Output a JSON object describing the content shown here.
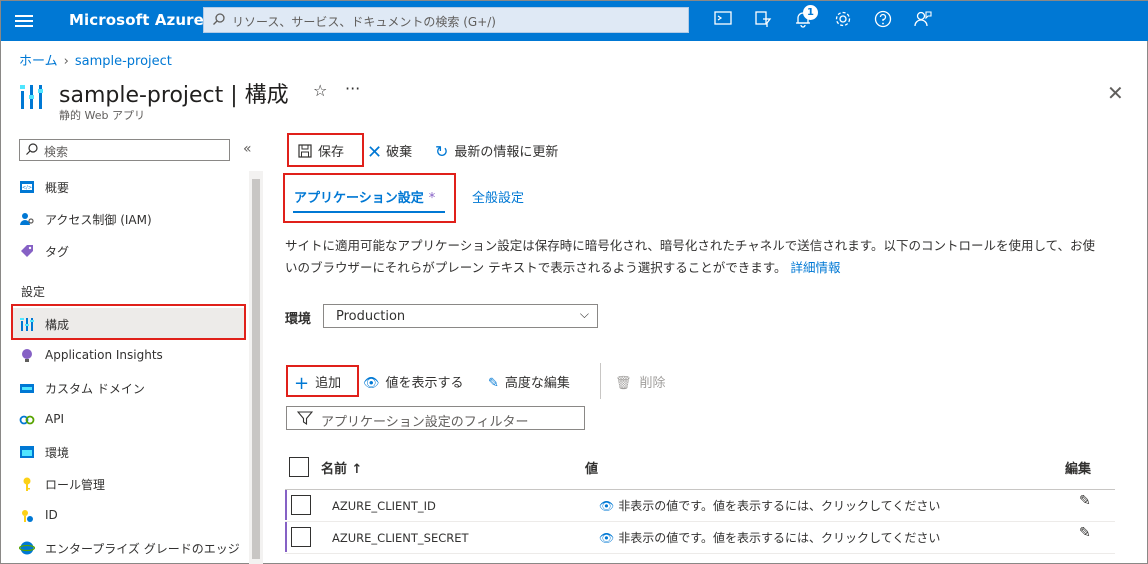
{
  "topbar": {
    "brand": "Microsoft Azure",
    "search_placeholder": "リソース、サービス、ドキュメントの検索 (G+/)",
    "notification_count": "1",
    "icons": [
      "cloud-shell-icon",
      "directory-filter-icon",
      "bell-icon",
      "gear-icon",
      "help-icon",
      "feedback-icon"
    ]
  },
  "breadcrumb": {
    "home": "ホーム",
    "current": "sample-project"
  },
  "header": {
    "title": "sample-project | 構成",
    "subtitle": "静的 Web アプリ"
  },
  "sidebar": {
    "search_placeholder": "検索",
    "items_top": [
      "概要",
      "アクセス制御 (IAM)",
      "タグ"
    ],
    "section": "設定",
    "items_settings": [
      "構成",
      "Application Insights",
      "カスタム ドメイン",
      "API",
      "環境",
      "ロール管理",
      "ID",
      "エンタープライズ グレードのエッジ"
    ]
  },
  "commands": {
    "save": "保存",
    "discard": "破棄",
    "refresh": "最新の情報に更新"
  },
  "tabs": {
    "app_settings": "アプリケーション設定",
    "modified_mark": "*",
    "general": "全般設定"
  },
  "description": {
    "text": "サイトに適用可能なアプリケーション設定は保存時に暗号化され、暗号化されたチャネルで送信されます。以下のコントロールを使用して、お使いのブラウザーにそれらがプレーン テキストで表示されるよう選択することができます。",
    "link": "詳細情報"
  },
  "environment": {
    "label": "環境",
    "selected": "Production"
  },
  "actions": {
    "add": "追加",
    "show_values": "値を表示する",
    "advanced_edit": "高度な編集",
    "delete": "削除"
  },
  "filter_placeholder": "アプリケーション設定のフィルター",
  "table": {
    "headers": {
      "name": "名前 ↑",
      "value": "値",
      "edit": "編集"
    },
    "rows": [
      {
        "name": "AZURE_CLIENT_ID",
        "value": "非表示の値です。値を表示するには、クリックしてください"
      },
      {
        "name": "AZURE_CLIENT_SECRET",
        "value": "非表示の値です。値を表示するには、クリックしてください"
      }
    ]
  },
  "colors": {
    "azure_blue": "#0078d4",
    "highlight_red": "#e0201a",
    "row_marker": "#8661c5"
  }
}
